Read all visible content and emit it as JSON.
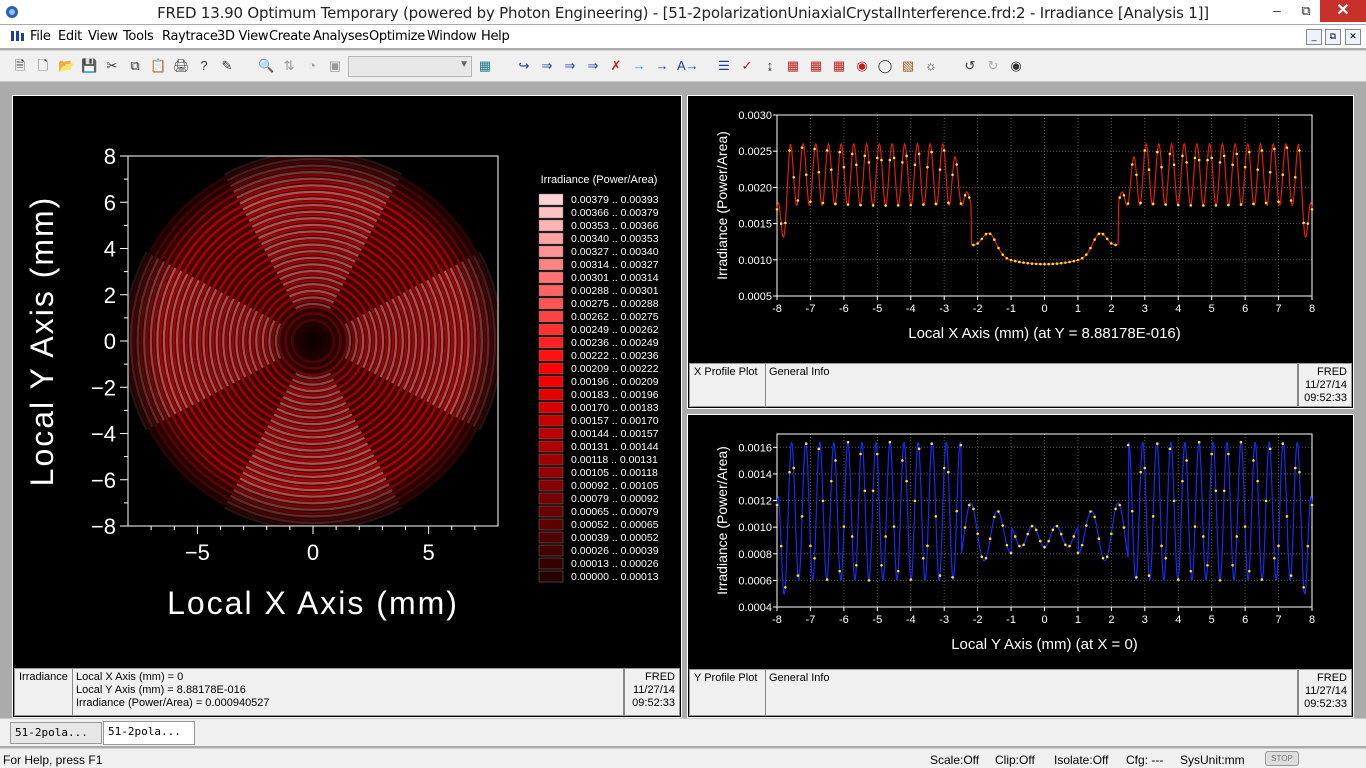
{
  "window": {
    "title": "FRED 13.90 Optimum Temporary (powered by Photon Engineering) - [51-2polarizationUniaxialCrystalInterference.frd:2 - Irradiance   [Analysis 1]]",
    "minimize": "–",
    "restore": "⧉",
    "close": "✕"
  },
  "menu": [
    "File",
    "Edit",
    "View",
    "Tools",
    "Raytrace",
    "3D View",
    "Create",
    "Analyses",
    "Optimize",
    "Window",
    "Help"
  ],
  "mdi_buttons": [
    "_",
    "⧉",
    "✕"
  ],
  "colors": {
    "map_red": "#e01010",
    "profile_x": "#e02000",
    "profile_y": "#1a2af0",
    "points": "#ffe01a"
  },
  "irradiance_map": {
    "xlabel": "Local X Axis (mm)",
    "ylabel": "Local Y Axis (mm)",
    "x_ticks": [
      "−5",
      "0",
      "5"
    ],
    "y_ticks": [
      "8",
      "6",
      "4",
      "2",
      "0",
      "−2",
      "−4",
      "−6",
      "−8"
    ],
    "legend_title": "Irradiance (Power/Area)",
    "legend": [
      "0.00379 .. 0.00393",
      "0.00366 .. 0.00379",
      "0.00353 .. 0.00366",
      "0.00340 .. 0.00353",
      "0.00327 .. 0.00340",
      "0.00314 .. 0.00327",
      "0.00301 .. 0.00314",
      "0.00288 .. 0.00301",
      "0.00275 .. 0.00288",
      "0.00262 .. 0.00275",
      "0.00249 .. 0.00262",
      "0.00236 .. 0.00249",
      "0.00222 .. 0.00236",
      "0.00209 .. 0.00222",
      "0.00196 .. 0.00209",
      "0.00183 .. 0.00196",
      "0.00170 .. 0.00183",
      "0.00157 .. 0.00170",
      "0.00144 .. 0.00157",
      "0.00131 .. 0.00144",
      "0.00118 .. 0.00131",
      "0.00105 .. 0.00118",
      "0.00092 .. 0.00105",
      "0.00079 .. 0.00092",
      "0.00065 .. 0.00079",
      "0.00052 .. 0.00065",
      "0.00039 .. 0.00052",
      "0.00026 .. 0.00039",
      "0.00013 .. 0.00026",
      "0.00000 .. 0.00013"
    ],
    "info_label": "Irradiance",
    "info_lines": [
      "Local X Axis (mm) = 0",
      "Local Y Axis (mm) = 8.88178E-016",
      "Irradiance (Power/Area) = 0.000940527"
    ],
    "info_fred": "FRED",
    "info_date": "11/27/14",
    "info_time": "09:52:33"
  },
  "x_profile": {
    "info_label": "X Profile Plot",
    "info_general": "General Info",
    "info_fred": "FRED",
    "info_date": "11/27/14",
    "info_time": "09:52:33"
  },
  "y_profile": {
    "info_label": "Y Profile Plot",
    "info_general": "General Info",
    "info_fred": "FRED",
    "info_date": "11/27/14",
    "info_time": "09:52:33"
  },
  "chart_data": [
    {
      "type": "line",
      "title": "",
      "xlabel": "Local X Axis (mm) (at Y = 8.88178E-016)",
      "ylabel": "Irradiance (Power/Area)",
      "xlim": [
        -8,
        8
      ],
      "ylim": [
        0.0005,
        0.003
      ],
      "x_ticks": [
        "-8",
        "-7",
        "-6",
        "-5",
        "-4",
        "-3",
        "-2",
        "-1",
        "0",
        "1",
        "2",
        "3",
        "4",
        "5",
        "6",
        "7",
        "8"
      ],
      "y_ticks": [
        "0.0030",
        "0.0025",
        "0.0020",
        "0.0015",
        "0.0010",
        "0.0005"
      ],
      "grid": true,
      "series": [
        {
          "x_range": [
            -8,
            8
          ],
          "sample_step": 0.125,
          "min": 0.00094,
          "max": 0.00275
        }
      ]
    },
    {
      "type": "line",
      "title": "",
      "xlabel": "Local Y Axis (mm) (at X = 0)",
      "ylabel": "Irradiance (Power/Area)",
      "xlim": [
        -8,
        8
      ],
      "ylim": [
        0.0004,
        0.0017
      ],
      "x_ticks": [
        "-8",
        "-7",
        "-6",
        "-5",
        "-4",
        "-3",
        "-2",
        "-1",
        "0",
        "1",
        "2",
        "3",
        "4",
        "5",
        "6",
        "7",
        "8"
      ],
      "y_ticks": [
        "0.0016",
        "0.0014",
        "0.0012",
        "0.0010",
        "0.0008",
        "0.0006",
        "0.0004"
      ],
      "grid": true,
      "series": [
        {
          "x_range": [
            -8,
            8
          ],
          "sample_step": 0.125,
          "min": 0.0005,
          "max": 0.00168
        }
      ]
    }
  ],
  "doc_tabs": [
    "51-2pola...",
    "51-2pola..."
  ],
  "status": {
    "help": "For Help, press F1",
    "scale": "Scale:Off",
    "clip": "Clip:Off",
    "isolate": "Isolate:Off",
    "cfg": "Cfg: ---",
    "sysunit": "SysUnit:mm",
    "stop": "STOP"
  }
}
